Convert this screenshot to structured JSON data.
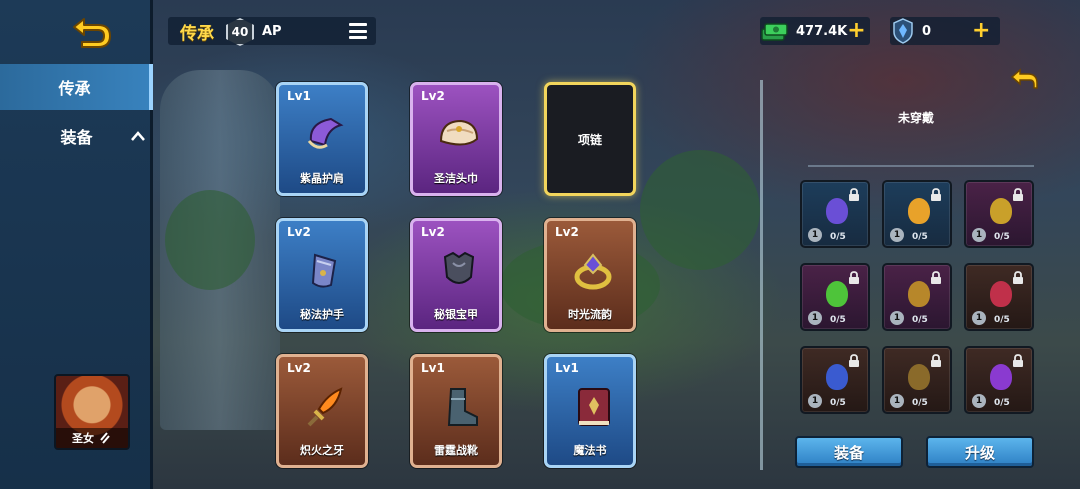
{
  "header": {
    "title": "传承",
    "level": "40",
    "ap_label": "AP"
  },
  "currencies": [
    {
      "value": "477.4K",
      "icon": "cash-stack-icon",
      "color": "#3ccf5c"
    },
    {
      "value": "0",
      "icon": "crystal-shield-icon",
      "color": "#6fb8ff"
    }
  ],
  "sidebar": {
    "tabs": [
      {
        "label": "传承",
        "active": true
      },
      {
        "label": "装备",
        "active": false
      }
    ],
    "hero_name": "圣女"
  },
  "items": [
    {
      "lv": "Lv1",
      "name": "紫晶护肩",
      "rarity": "blue",
      "icon": "pauldron-icon"
    },
    {
      "lv": "Lv2",
      "name": "圣洁头巾",
      "rarity": "purple",
      "icon": "turban-icon"
    },
    {
      "lv": "",
      "name": "项链",
      "rarity": "empty",
      "icon": ""
    },
    {
      "lv": "Lv2",
      "name": "秘法护手",
      "rarity": "blue",
      "icon": "gauntlet-icon"
    },
    {
      "lv": "Lv2",
      "name": "秘银宝甲",
      "rarity": "purple",
      "icon": "armor-icon"
    },
    {
      "lv": "Lv2",
      "name": "时光流韵",
      "rarity": "brown",
      "icon": "ring-icon"
    },
    {
      "lv": "Lv2",
      "name": "炽火之牙",
      "rarity": "brown",
      "icon": "dagger-icon"
    },
    {
      "lv": "Lv1",
      "name": "雷霆战靴",
      "rarity": "brown",
      "icon": "boots-icon"
    },
    {
      "lv": "Lv1",
      "name": "魔法书",
      "rarity": "blue",
      "icon": "spellbook-icon"
    }
  ],
  "right_panel": {
    "status": "未穿戴",
    "necklaces": [
      {
        "count": "1",
        "progress": "0/5",
        "rarity": "blue",
        "color": "#6a4fd6"
      },
      {
        "count": "1",
        "progress": "0/5",
        "rarity": "blue",
        "color": "#e8a22a"
      },
      {
        "count": "1",
        "progress": "0/5",
        "rarity": "purple",
        "color": "#c9a02a"
      },
      {
        "count": "1",
        "progress": "0/5",
        "rarity": "purple",
        "color": "#4ec43a"
      },
      {
        "count": "1",
        "progress": "0/5",
        "rarity": "purple",
        "color": "#b7872a"
      },
      {
        "count": "1",
        "progress": "0/5",
        "rarity": "brown",
        "color": "#c0304a"
      },
      {
        "count": "1",
        "progress": "0/5",
        "rarity": "brown",
        "color": "#3a5bd0"
      },
      {
        "count": "1",
        "progress": "0/5",
        "rarity": "brown",
        "color": "#8a6a2a"
      },
      {
        "count": "1",
        "progress": "0/5",
        "rarity": "brown",
        "color": "#8a3ad0"
      }
    ],
    "equip_label": "装备",
    "upgrade_label": "升级"
  }
}
